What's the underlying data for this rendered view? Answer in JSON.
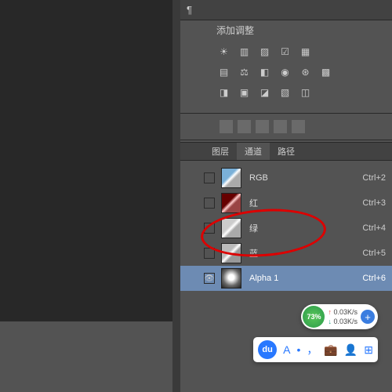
{
  "header": {
    "adjustments_title": "添加调整"
  },
  "tabs": {
    "layers": "图层",
    "channels": "通道",
    "paths": "路径"
  },
  "channels": [
    {
      "name": "RGB",
      "hotkey": "Ctrl+2",
      "visible": false,
      "selected": false,
      "thumb": "rgb"
    },
    {
      "name": "红",
      "hotkey": "Ctrl+3",
      "visible": false,
      "selected": false,
      "thumb": "red"
    },
    {
      "name": "绿",
      "hotkey": "Ctrl+4",
      "visible": false,
      "selected": false,
      "thumb": "green"
    },
    {
      "name": "蓝",
      "hotkey": "Ctrl+5",
      "visible": false,
      "selected": false,
      "thumb": "blue"
    },
    {
      "name": "Alpha 1",
      "hotkey": "Ctrl+6",
      "visible": true,
      "selected": true,
      "thumb": "alpha"
    }
  ],
  "speed": {
    "percent": "73%",
    "up": "0.03K/s",
    "down": "0.03K/s"
  },
  "toolbar": {
    "letter": "A",
    "dot": "•",
    "comma": "，",
    "briefcase": "💼",
    "person": "👤",
    "grid": "⊞"
  }
}
